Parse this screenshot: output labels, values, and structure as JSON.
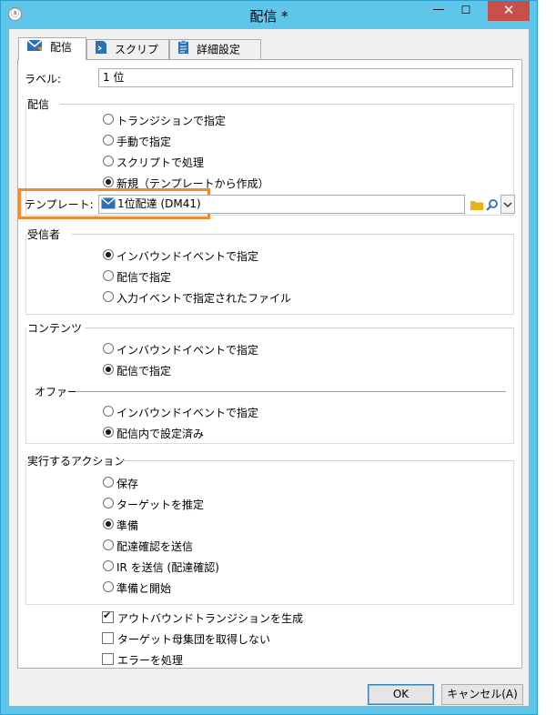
{
  "window": {
    "title": "配信 *",
    "min_icon": "minimize-icon",
    "max_icon": "maximize-icon",
    "close_icon": "close-icon"
  },
  "tabs": [
    {
      "label": "配信",
      "icon": "envelope-icon",
      "active": true
    },
    {
      "label": "スクリプト",
      "icon": "script-icon",
      "active": false
    },
    {
      "label": "詳細設定",
      "icon": "clipboard-icon",
      "active": false
    }
  ],
  "label_field": {
    "label": "ラベル:",
    "value": "1 位"
  },
  "delivery_group": {
    "title": "配信",
    "options": [
      {
        "label": "トランジションで指定",
        "selected": false
      },
      {
        "label": "手動で指定",
        "selected": false
      },
      {
        "label": "スクリプトで処理",
        "selected": false
      },
      {
        "label": "新規（テンプレートから作成）",
        "selected": true
      }
    ],
    "template_label": "テンプレート:",
    "template_value": "1位配達 (DM41)"
  },
  "recipient_group": {
    "title": "受信者",
    "options": [
      {
        "label": "インバウンドイベントで指定",
        "selected": true
      },
      {
        "label": "配信で指定",
        "selected": false
      },
      {
        "label": "入力イベントで指定されたファイル",
        "selected": false
      }
    ]
  },
  "content_group": {
    "title": "コンテンツ",
    "options": [
      {
        "label": "インバウンドイベントで指定",
        "selected": false
      },
      {
        "label": "配信で指定",
        "selected": true
      }
    ],
    "offer_title": "オファー",
    "offer_options": [
      {
        "label": "インバウンドイベントで指定",
        "selected": false
      },
      {
        "label": "配信内で設定済み",
        "selected": true
      }
    ]
  },
  "action_group": {
    "title": "実行するアクション",
    "options": [
      {
        "label": "保存",
        "selected": false
      },
      {
        "label": "ターゲットを推定",
        "selected": false
      },
      {
        "label": "準備",
        "selected": true
      },
      {
        "label": "配達確認を送信",
        "selected": false
      },
      {
        "label": "IR を送信 (配達確認)",
        "selected": false
      },
      {
        "label": "準備と開始",
        "selected": false
      }
    ]
  },
  "checkboxes": [
    {
      "label": "アウトバウンドトランジションを生成",
      "checked": true
    },
    {
      "label": "ターゲット母集団を取得しない",
      "checked": false
    },
    {
      "label": "エラーを処理",
      "checked": false
    }
  ],
  "buttons": {
    "ok": "OK",
    "cancel": "キャンセル(A)"
  },
  "colors": {
    "titlebar": "#5fc6ea",
    "highlight": "#f08c2b",
    "close": "#c7504b"
  }
}
